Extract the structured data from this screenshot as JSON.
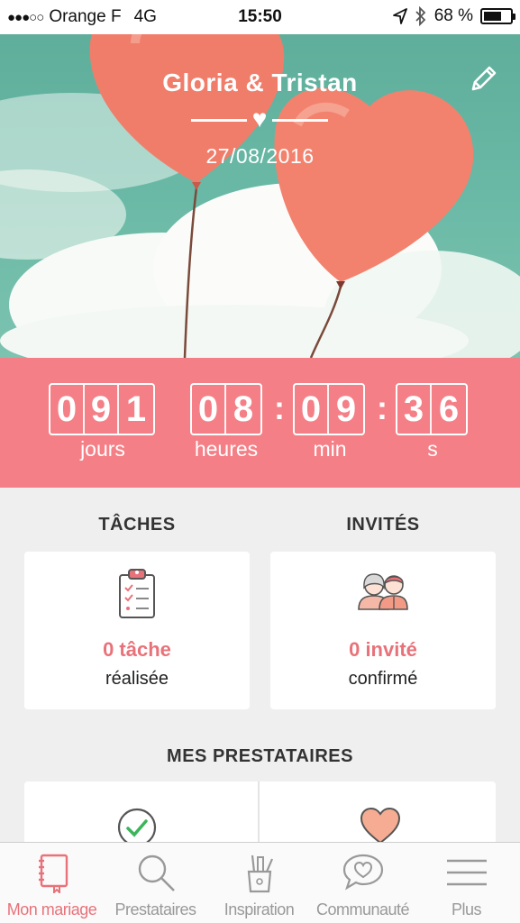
{
  "status_bar": {
    "signal": "●●●○○",
    "carrier": "Orange F",
    "network": "4G",
    "time": "15:50",
    "battery_percent_label": "68 %",
    "battery_level": 0.68,
    "icons": [
      "location-arrow-icon",
      "bluetooth-icon",
      "battery-icon"
    ]
  },
  "hero": {
    "couple_names": "Gloria & Tristan",
    "wedding_date": "27/08/2016",
    "edit_icon": "pencil-icon",
    "divider_heart": "♥"
  },
  "countdown": {
    "days": [
      "0",
      "9",
      "1"
    ],
    "hours": [
      "0",
      "8"
    ],
    "minutes": [
      "0",
      "9"
    ],
    "seconds": [
      "3",
      "6"
    ],
    "separator": ":",
    "labels": {
      "days": "jours",
      "hours": "heures",
      "minutes": "min",
      "seconds": "s"
    }
  },
  "tasks": {
    "title": "TÂCHES",
    "count_text": "0 tâche",
    "status_text": "réalisée",
    "icon": "clipboard-checklist-icon"
  },
  "guests": {
    "title": "INVITÉS",
    "count_text": "0 invité",
    "status_text": "confirmé",
    "icon": "couple-avatars-icon"
  },
  "vendors": {
    "title": "MES PRESTATAIRES",
    "cards": [
      {
        "icon": "check-circle-icon"
      },
      {
        "icon": "heart-icon"
      }
    ]
  },
  "tab_bar": {
    "items": [
      {
        "label": "Mon mariage",
        "icon": "notebook-icon",
        "active": true
      },
      {
        "label": "Prestataires",
        "icon": "search-icon",
        "active": false
      },
      {
        "label": "Inspiration",
        "icon": "pencil-cup-icon",
        "active": false
      },
      {
        "label": "Communauté",
        "icon": "chat-heart-icon",
        "active": false
      },
      {
        "label": "Plus",
        "icon": "menu-icon",
        "active": false
      }
    ]
  },
  "colors": {
    "accent": "#f47f86",
    "accent_text": "#e8727a",
    "sky": "#68b8a5",
    "balloon": "#f07d6a",
    "background": "#efefef"
  }
}
